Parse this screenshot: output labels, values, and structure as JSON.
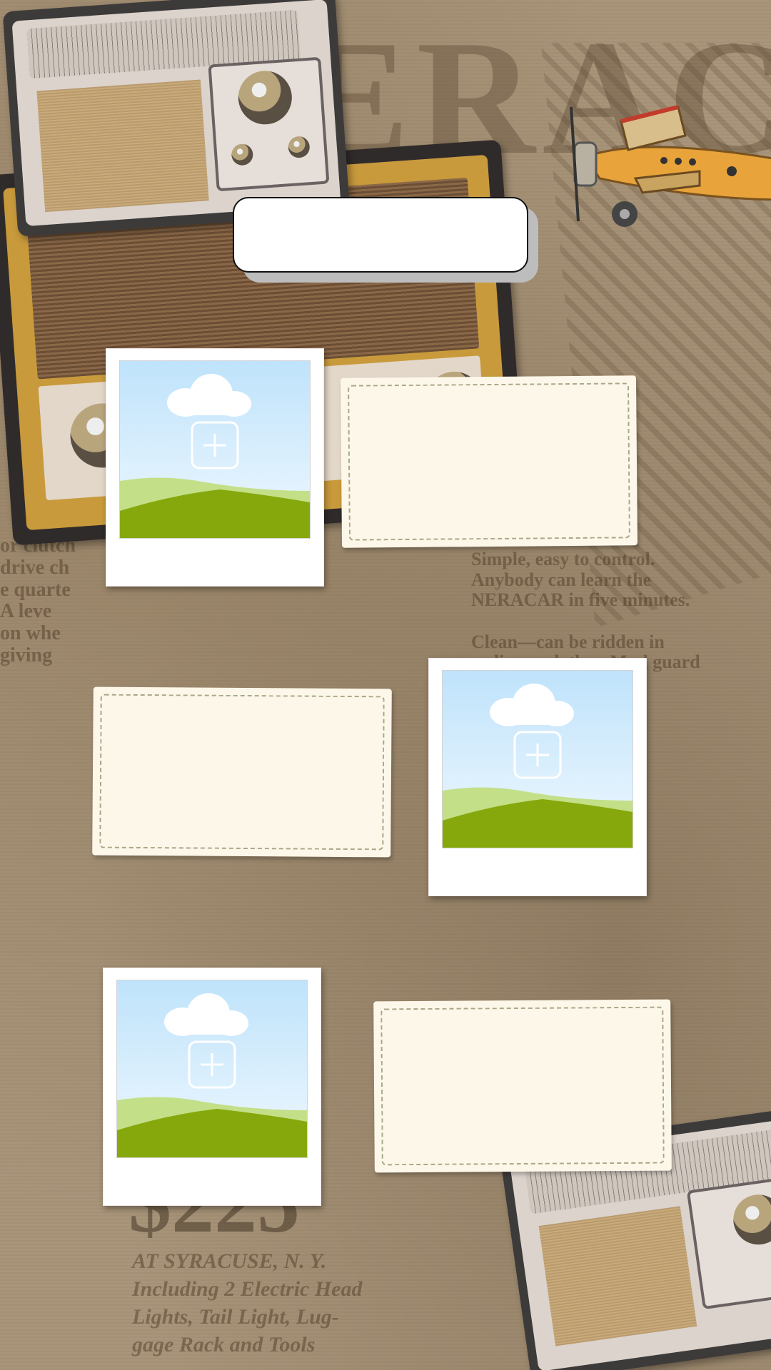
{
  "title_plate": {
    "text": ""
  },
  "polaroids": [
    {
      "name": "photo-slot-1",
      "icon": "add-photo-icon"
    },
    {
      "name": "photo-slot-2",
      "icon": "add-photo-icon"
    },
    {
      "name": "photo-slot-3",
      "icon": "add-photo-icon"
    }
  ],
  "notes": [
    {
      "value": "",
      "placeholder": ""
    },
    {
      "value": "",
      "placeholder": ""
    },
    {
      "value": "",
      "placeholder": ""
    }
  ],
  "colors": {
    "background_paper": "#a8957a",
    "note_fill": "#fdf7ea",
    "note_dash": "#a7a887",
    "grass_dark": "#86a80c",
    "grass_light": "#c3df88",
    "sky": "#bfe3fb"
  }
}
